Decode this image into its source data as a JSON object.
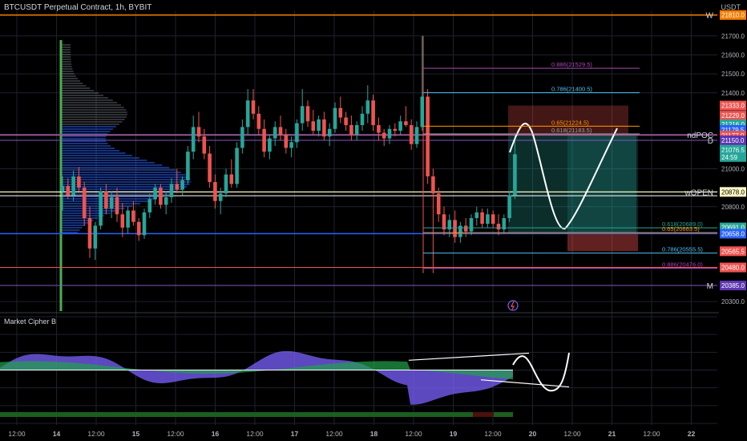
{
  "header": {
    "title": "BTCUSDT Perpetual Contract, 1h, BYBIT",
    "currency": "USDT"
  },
  "indicator": {
    "name": "Market Cipher B"
  },
  "icons": {
    "lightning": "lightning-icon"
  },
  "colors": {
    "up": "#26a69a",
    "down": "#ef5350",
    "bg": "#000000",
    "grid": "#1e222d",
    "axisText": "#b2b5be",
    "wave": "#7b61ff",
    "money": "#21a34a"
  },
  "chart_data": [
    {
      "type": "candlestick",
      "symbol": "BTCUSDT",
      "interval": "1h",
      "ylim": [
        20250,
        21830
      ],
      "y_ticks": [
        21700.0,
        21600.0,
        21500.0,
        21400.0,
        21000.0,
        20800.0,
        20300.0
      ],
      "x_ticks": [
        "12:00",
        "14",
        "12:00",
        "15",
        "12:00",
        "16",
        "12:00",
        "17",
        "12:00",
        "18",
        "12:00",
        "19",
        "12:00",
        "20",
        "12:00",
        "21",
        "12:00",
        "22"
      ],
      "price_labels": [
        {
          "value": "21810.0",
          "color": "#f57c00"
        },
        {
          "value": "21333.0",
          "color": "#ef5350"
        },
        {
          "value": "21229.0",
          "color": "#ef5350"
        },
        {
          "value": "21216.0",
          "color": "#26a69a"
        },
        {
          "value": "21179.5",
          "color": "#2962ff"
        },
        {
          "value": "21177.0",
          "color": "#ef5350"
        },
        {
          "value": "21150.0",
          "color": "#5e35b1"
        },
        {
          "value": "21076.5",
          "color": "#26a69a"
        },
        {
          "value": "24:59",
          "color": "#26a69a"
        },
        {
          "value": "20878.0",
          "color": "#fff9c4"
        },
        {
          "value": "20691.0",
          "color": "#26a69a"
        },
        {
          "value": "20658.0",
          "color": "#2962ff"
        },
        {
          "value": "20565.5",
          "color": "#ef5350"
        },
        {
          "value": "20480.0",
          "color": "#ef5350"
        },
        {
          "value": "20385.0",
          "color": "#5e35b1"
        }
      ],
      "level_tags": [
        {
          "text": "W",
          "value": 21810
        },
        {
          "text": "ndPOC",
          "value": 21179
        },
        {
          "text": "D",
          "value": 21150
        },
        {
          "text": "wOPEN",
          "value": 20878
        },
        {
          "text": "M",
          "value": 20385
        }
      ],
      "fib_labels": [
        {
          "text": "0.886(21529.5)",
          "value": 21529.5,
          "color": "#ab47bc"
        },
        {
          "text": "0.786(21400.5)",
          "value": 21400.5,
          "color": "#4fc3f7"
        },
        {
          "text": "0.65(21224.5)",
          "value": 21224.5,
          "color": "#ff9800"
        },
        {
          "text": "0.618(21183.5)",
          "value": 21183.5,
          "color": "#9e9e9e"
        },
        {
          "text": "0.618(20689.0)",
          "value": 20689.0,
          "color": "#26a69a"
        },
        {
          "text": "0.65(20663.5)",
          "value": 20663.5,
          "color": "#ff9800"
        },
        {
          "text": "0.786(20555.5)",
          "value": 20555.5,
          "color": "#4fc3f7"
        },
        {
          "text": "0.886(20476.0)",
          "value": 20476.0,
          "color": "#ab47bc"
        }
      ],
      "candles": [
        {
          "o": 20880,
          "h": 20960,
          "l": 20780,
          "c": 20910
        },
        {
          "o": 20910,
          "h": 20950,
          "l": 20840,
          "c": 20860
        },
        {
          "o": 20860,
          "h": 20990,
          "l": 20830,
          "c": 20960
        },
        {
          "o": 20960,
          "h": 21010,
          "l": 20880,
          "c": 20900
        },
        {
          "o": 20900,
          "h": 20930,
          "l": 20700,
          "c": 20740
        },
        {
          "o": 20740,
          "h": 20800,
          "l": 20530,
          "c": 20580
        },
        {
          "o": 20580,
          "h": 20720,
          "l": 20520,
          "c": 20700
        },
        {
          "o": 20700,
          "h": 20900,
          "l": 20680,
          "c": 20880
        },
        {
          "o": 20880,
          "h": 20920,
          "l": 20760,
          "c": 20790
        },
        {
          "o": 20790,
          "h": 20880,
          "l": 20740,
          "c": 20850
        },
        {
          "o": 20850,
          "h": 20900,
          "l": 20720,
          "c": 20760
        },
        {
          "o": 20760,
          "h": 20820,
          "l": 20640,
          "c": 20690
        },
        {
          "o": 20690,
          "h": 20800,
          "l": 20660,
          "c": 20780
        },
        {
          "o": 20780,
          "h": 20830,
          "l": 20700,
          "c": 20720
        },
        {
          "o": 20720,
          "h": 20740,
          "l": 20620,
          "c": 20650
        },
        {
          "o": 20650,
          "h": 20790,
          "l": 20630,
          "c": 20770
        },
        {
          "o": 20770,
          "h": 20870,
          "l": 20740,
          "c": 20840
        },
        {
          "o": 20840,
          "h": 20920,
          "l": 20810,
          "c": 20900
        },
        {
          "o": 20900,
          "h": 20920,
          "l": 20790,
          "c": 20810
        },
        {
          "o": 20810,
          "h": 20880,
          "l": 20760,
          "c": 20850
        },
        {
          "o": 20850,
          "h": 20950,
          "l": 20820,
          "c": 20920
        },
        {
          "o": 20920,
          "h": 21000,
          "l": 20870,
          "c": 20890
        },
        {
          "o": 20890,
          "h": 20960,
          "l": 20860,
          "c": 20940
        },
        {
          "o": 20940,
          "h": 21120,
          "l": 20920,
          "c": 21090
        },
        {
          "o": 21090,
          "h": 21280,
          "l": 21050,
          "c": 21220
        },
        {
          "o": 21220,
          "h": 21300,
          "l": 21140,
          "c": 21170
        },
        {
          "o": 21170,
          "h": 21210,
          "l": 21050,
          "c": 21080
        },
        {
          "o": 21080,
          "h": 21120,
          "l": 20900,
          "c": 20930
        },
        {
          "o": 20930,
          "h": 20970,
          "l": 20790,
          "c": 20830
        },
        {
          "o": 20830,
          "h": 20900,
          "l": 20760,
          "c": 20870
        },
        {
          "o": 20870,
          "h": 21000,
          "l": 20850,
          "c": 20970
        },
        {
          "o": 20970,
          "h": 21050,
          "l": 20900,
          "c": 20920
        },
        {
          "o": 20920,
          "h": 21140,
          "l": 20900,
          "c": 21110
        },
        {
          "o": 21110,
          "h": 21260,
          "l": 21080,
          "c": 21220
        },
        {
          "o": 21220,
          "h": 21420,
          "l": 21180,
          "c": 21360
        },
        {
          "o": 21360,
          "h": 21420,
          "l": 21260,
          "c": 21290
        },
        {
          "o": 21290,
          "h": 21330,
          "l": 21180,
          "c": 21210
        },
        {
          "o": 21210,
          "h": 21260,
          "l": 21060,
          "c": 21090
        },
        {
          "o": 21090,
          "h": 21180,
          "l": 21050,
          "c": 21160
        },
        {
          "o": 21160,
          "h": 21250,
          "l": 21120,
          "c": 21220
        },
        {
          "o": 21220,
          "h": 21280,
          "l": 21150,
          "c": 21180
        },
        {
          "o": 21180,
          "h": 21210,
          "l": 21080,
          "c": 21110
        },
        {
          "o": 21110,
          "h": 21170,
          "l": 21060,
          "c": 21140
        },
        {
          "o": 21140,
          "h": 21260,
          "l": 21110,
          "c": 21240
        },
        {
          "o": 21240,
          "h": 21420,
          "l": 21200,
          "c": 21330
        },
        {
          "o": 21330,
          "h": 21360,
          "l": 21220,
          "c": 21250
        },
        {
          "o": 21250,
          "h": 21310,
          "l": 21180,
          "c": 21200
        },
        {
          "o": 21200,
          "h": 21280,
          "l": 21170,
          "c": 21260
        },
        {
          "o": 21260,
          "h": 21300,
          "l": 21150,
          "c": 21170
        },
        {
          "o": 21170,
          "h": 21240,
          "l": 21120,
          "c": 21210
        },
        {
          "o": 21210,
          "h": 21350,
          "l": 21190,
          "c": 21320
        },
        {
          "o": 21320,
          "h": 21380,
          "l": 21240,
          "c": 21270
        },
        {
          "o": 21270,
          "h": 21300,
          "l": 21200,
          "c": 21230
        },
        {
          "o": 21230,
          "h": 21280,
          "l": 21150,
          "c": 21180
        },
        {
          "o": 21180,
          "h": 21250,
          "l": 21150,
          "c": 21230
        },
        {
          "o": 21230,
          "h": 21330,
          "l": 21200,
          "c": 21290
        },
        {
          "o": 21290,
          "h": 21440,
          "l": 21240,
          "c": 21360
        },
        {
          "o": 21360,
          "h": 21390,
          "l": 21200,
          "c": 21230
        },
        {
          "o": 21230,
          "h": 21270,
          "l": 21150,
          "c": 21190
        },
        {
          "o": 21190,
          "h": 21210,
          "l": 21120,
          "c": 21160
        },
        {
          "o": 21160,
          "h": 21230,
          "l": 21130,
          "c": 21210
        },
        {
          "o": 21210,
          "h": 21240,
          "l": 21170,
          "c": 21200
        },
        {
          "o": 21200,
          "h": 21280,
          "l": 21180,
          "c": 21250
        },
        {
          "o": 21250,
          "h": 21330,
          "l": 21220,
          "c": 21230
        },
        {
          "o": 21230,
          "h": 21260,
          "l": 21100,
          "c": 21130
        },
        {
          "o": 21130,
          "h": 21250,
          "l": 21110,
          "c": 21220
        },
        {
          "o": 21220,
          "h": 21700,
          "l": 21200,
          "c": 21380
        },
        {
          "o": 21380,
          "h": 21420,
          "l": 20920,
          "c": 20960
        },
        {
          "o": 20960,
          "h": 21000,
          "l": 20450,
          "c": 20870
        },
        {
          "o": 20870,
          "h": 20900,
          "l": 20720,
          "c": 20760
        },
        {
          "o": 20760,
          "h": 20800,
          "l": 20650,
          "c": 20680
        },
        {
          "o": 20680,
          "h": 20760,
          "l": 20640,
          "c": 20730
        },
        {
          "o": 20730,
          "h": 20780,
          "l": 20610,
          "c": 20640
        },
        {
          "o": 20640,
          "h": 20720,
          "l": 20610,
          "c": 20700
        },
        {
          "o": 20700,
          "h": 20740,
          "l": 20640,
          "c": 20670
        },
        {
          "o": 20670,
          "h": 20760,
          "l": 20650,
          "c": 20740
        },
        {
          "o": 20740,
          "h": 20800,
          "l": 20700,
          "c": 20770
        },
        {
          "o": 20770,
          "h": 20790,
          "l": 20690,
          "c": 20710
        },
        {
          "o": 20710,
          "h": 20790,
          "l": 20690,
          "c": 20760
        },
        {
          "o": 20760,
          "h": 20780,
          "l": 20690,
          "c": 20710
        },
        {
          "o": 20710,
          "h": 20760,
          "l": 20650,
          "c": 20680
        },
        {
          "o": 20680,
          "h": 20760,
          "l": 20660,
          "c": 20740
        },
        {
          "o": 20740,
          "h": 20880,
          "l": 20720,
          "c": 20860
        },
        {
          "o": 20860,
          "h": 21180,
          "l": 20840,
          "c": 21076.5
        }
      ]
    },
    {
      "type": "oscillator",
      "name": "Market Cipher B",
      "ylim": [
        -120,
        120
      ],
      "y_ticks": [
        "120.0",
        "80.0",
        "40.0",
        "0.0",
        "−40.0",
        "−80.0",
        "−120.0"
      ]
    }
  ]
}
